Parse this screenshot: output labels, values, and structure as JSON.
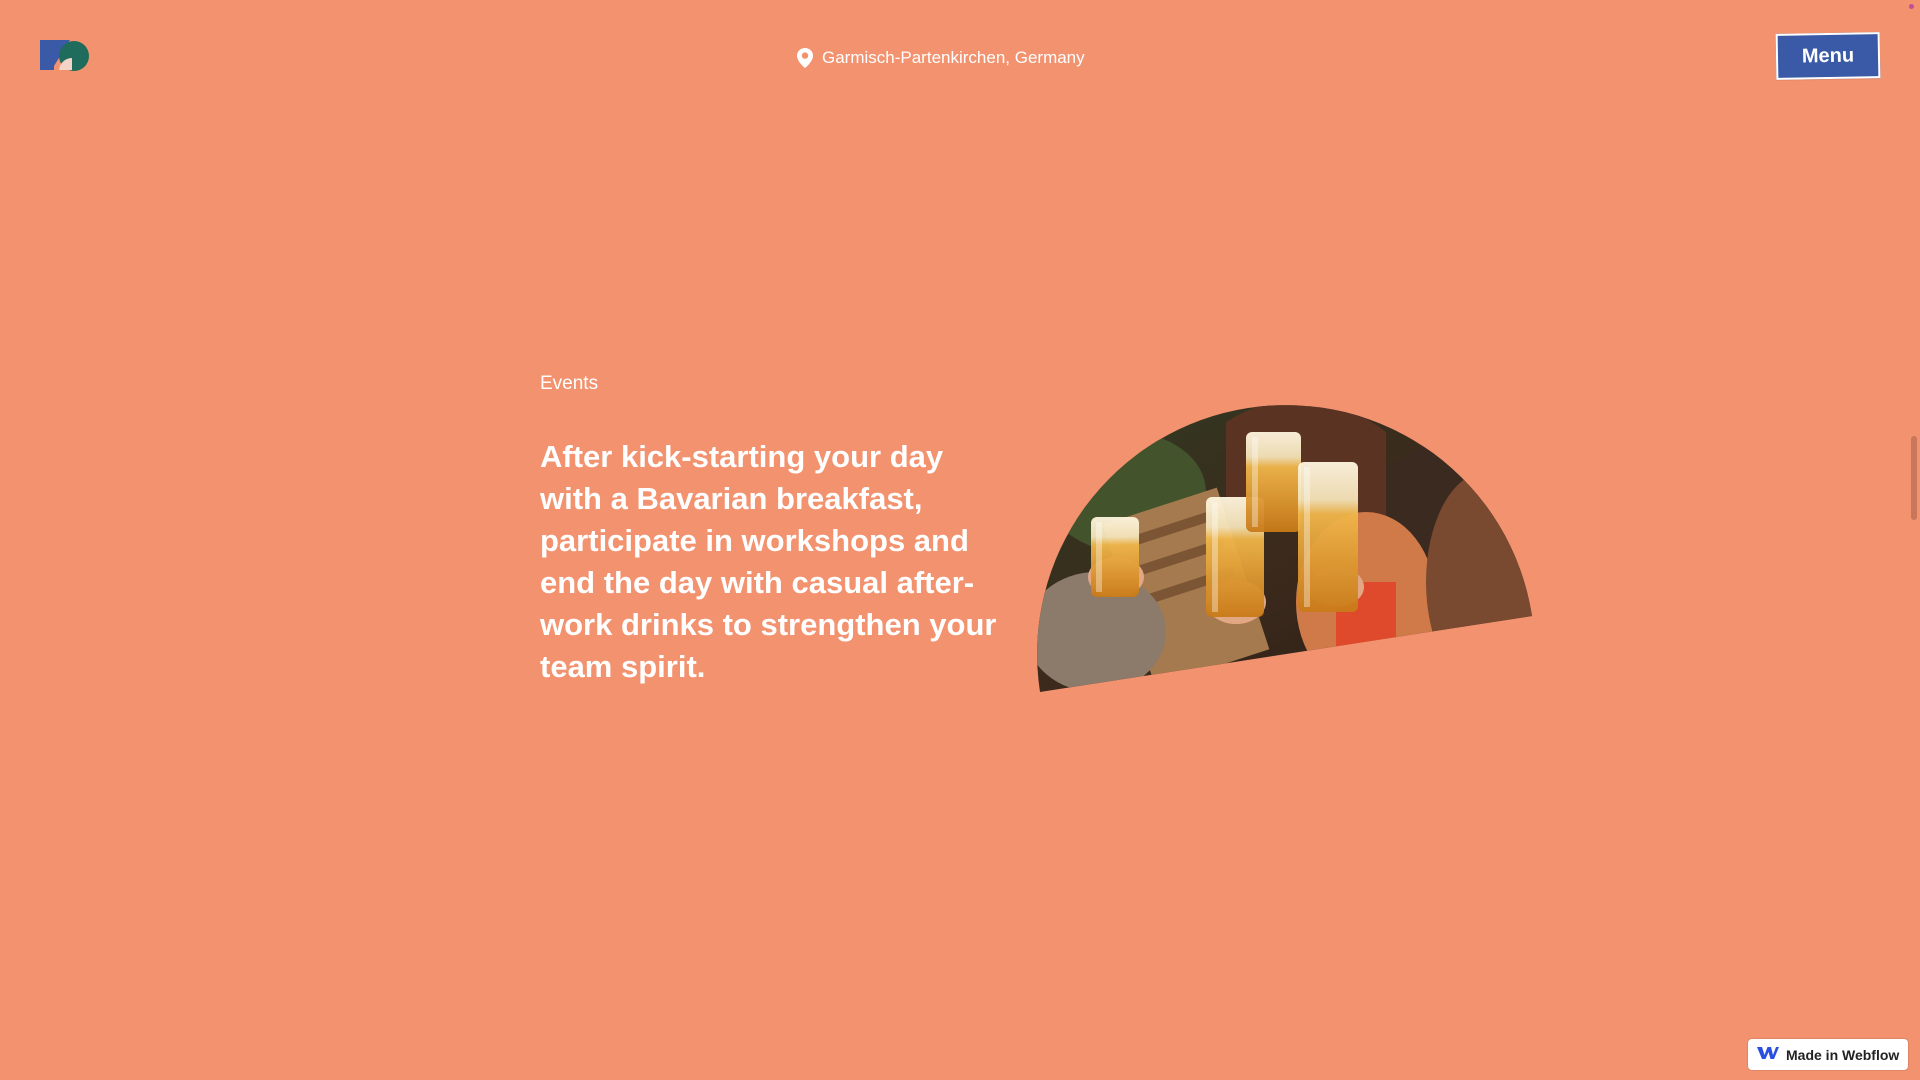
{
  "header": {
    "location": "Garmisch-Partenkirchen, Germany",
    "menu_label": "Menu"
  },
  "main": {
    "section_label": "Events",
    "headline": "After kick-starting your day with a Bavarian breakfast, participate in workshops and end the day with casual after-work drinks to strengthen your team spirit."
  },
  "badge": {
    "label": "Made in Webflow"
  },
  "colors": {
    "background": "#f2926f",
    "menu_button": "#3a5aa8",
    "logo_blue": "#3a5aa8",
    "logo_green": "#1f6b5c",
    "text": "#ffffff"
  },
  "icons": {
    "location": "map-pin-icon",
    "logo": "brand-logo-icon",
    "webflow": "webflow-logo-icon"
  }
}
